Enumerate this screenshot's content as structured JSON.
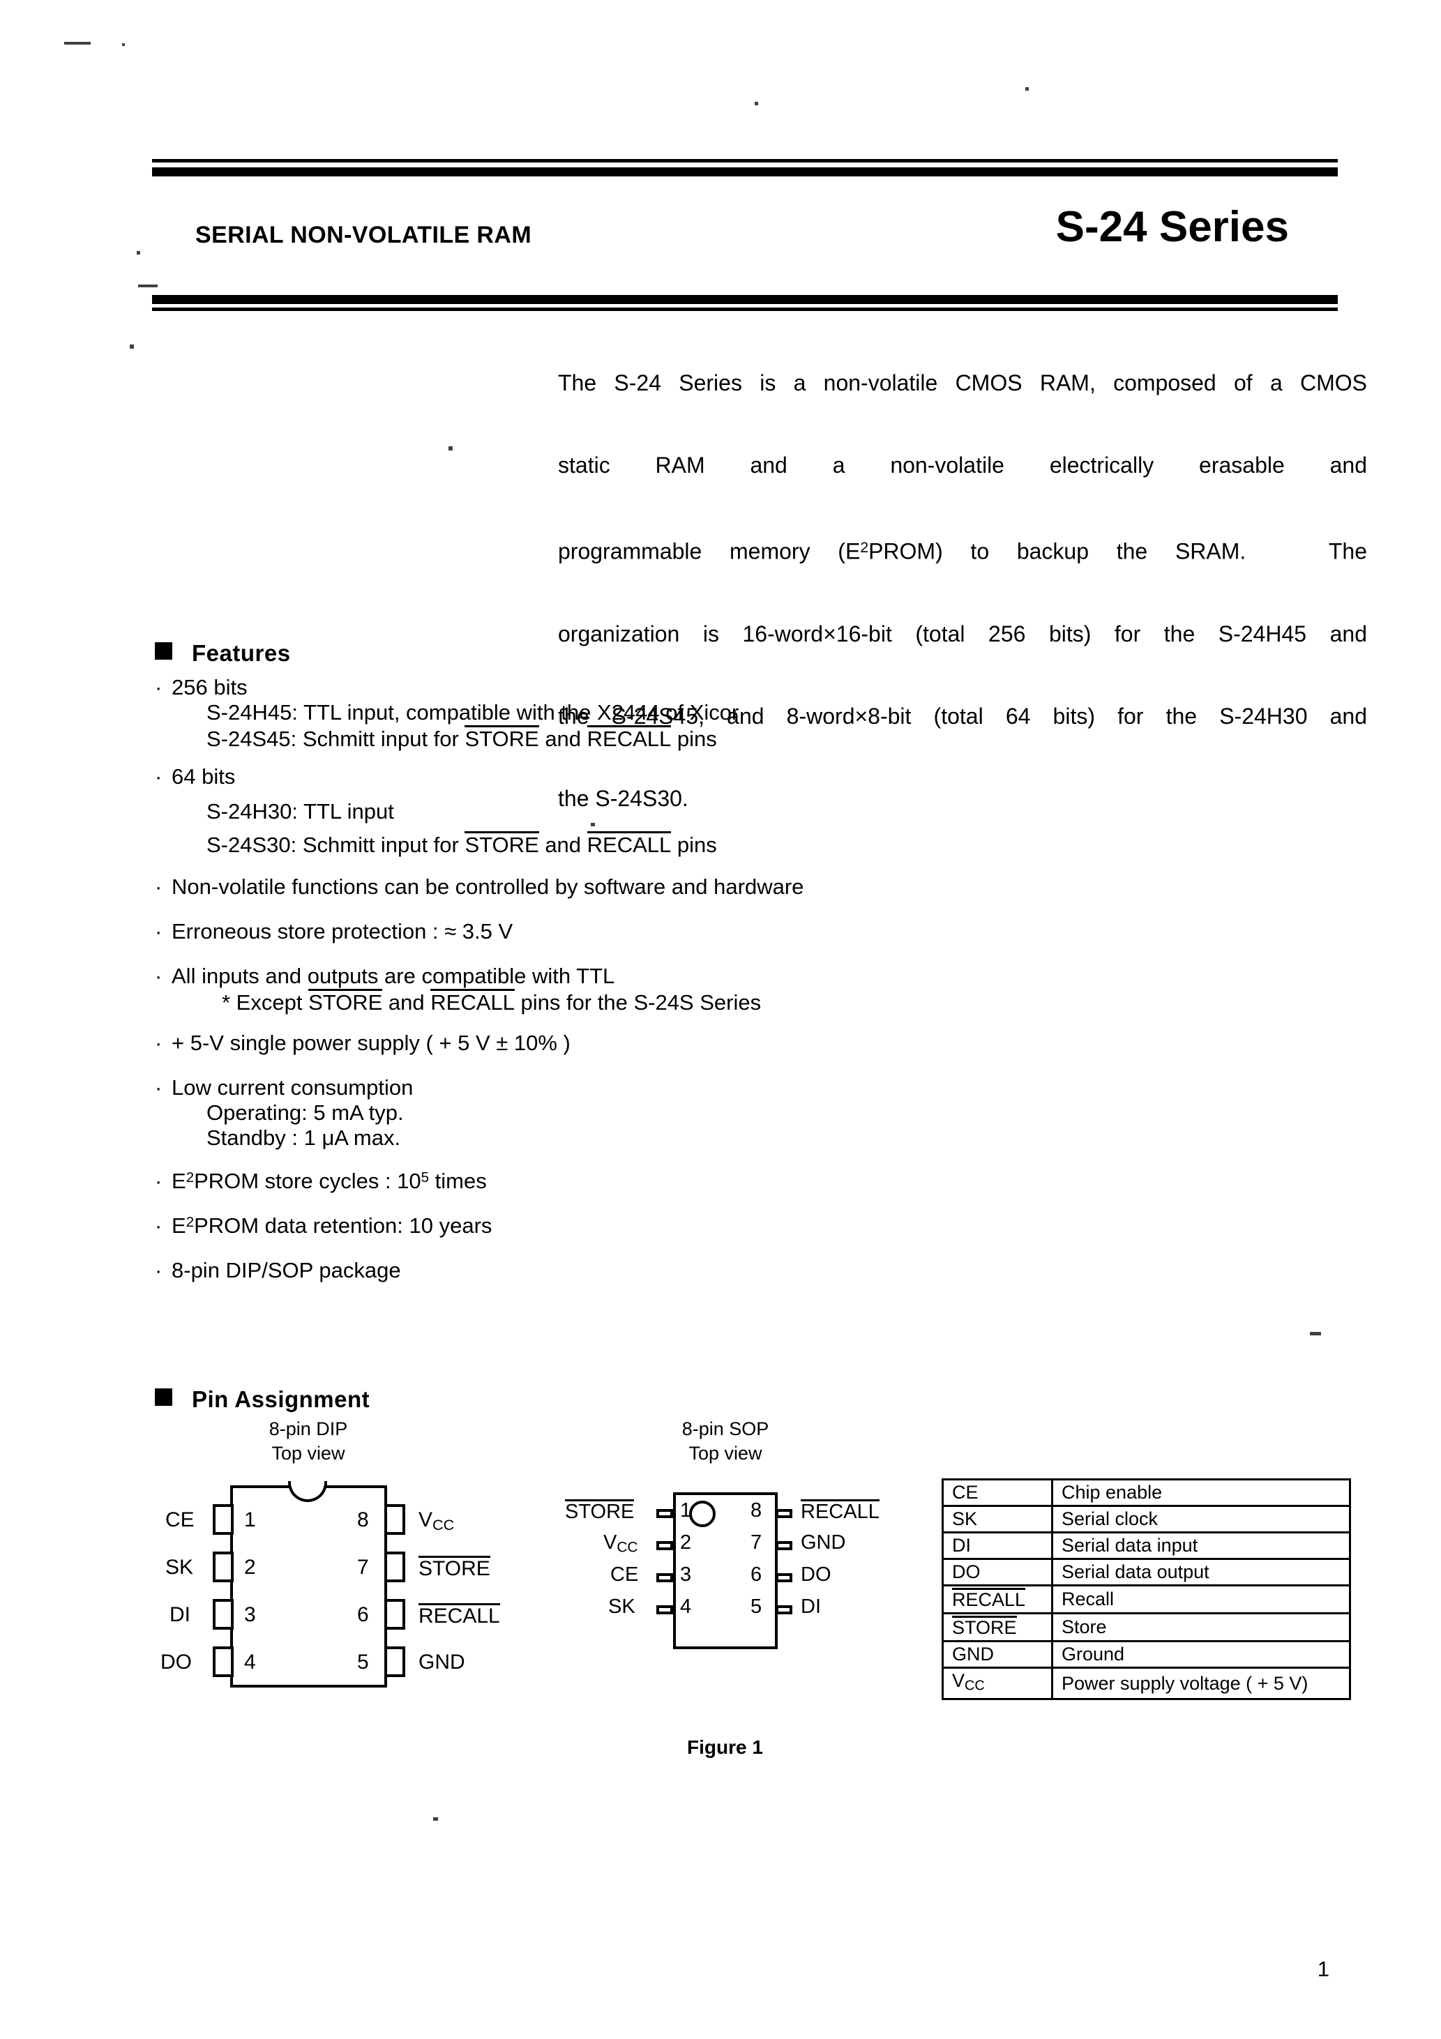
{
  "header": {
    "subtitle": "SERIAL NON-VOLATILE RAM",
    "title": "S-24 Series"
  },
  "intro": {
    "line1": "The S-24 Series is a non-volatile CMOS RAM, composed of a CMOS",
    "line2": "static RAM and a non-volatile electrically erasable and",
    "line3": "programmable memory (E2PROM) to backup the SRAM.   The",
    "line4": "organization is 16-word×16-bit (total 256 bits) for the S-24H45 and",
    "line5": "the S-24S45, and 8-word×8-bit (total 64 bits) for the S-24H30 and",
    "line6": "the S-24S30."
  },
  "features": {
    "heading": "Features",
    "items": [
      {
        "main": "256 bits",
        "subs": [
          "S-24H45: TTL input, compatible with the X2444 of Xicor",
          "S-24S45: Schmitt input for STORE and RECALL pins"
        ]
      },
      {
        "main": "64 bits",
        "subs": [
          "S-24H30: TTL input",
          "S-24S30: Schmitt input for STORE and RECALL pins"
        ]
      },
      {
        "main": "Non-volatile functions can be controlled by software and hardware",
        "subs": []
      },
      {
        "main": "Erroneous store protection : ≈ 3.5 V",
        "subs": []
      },
      {
        "main": "All inputs and outputs are compatible with TTL",
        "subs": [
          "* Except STORE and RECALL pins for the S-24S Series"
        ]
      },
      {
        "main": "+ 5-V single power supply ( + 5 V ± 10% )",
        "subs": []
      },
      {
        "main": "Low current consumption",
        "subs": [
          "Operating:  5 mA typ.",
          "Standby  :  1 μA  max."
        ]
      },
      {
        "main": "E2PROM store cycles : 105 times",
        "subs": []
      },
      {
        "main": "E2PROM data retention: 10 years",
        "subs": []
      },
      {
        "main": "8-pin DIP/SOP package",
        "subs": []
      }
    ],
    "labels": {
      "f1_main": "256 bits",
      "f1_s1": "S-24H45: TTL input, compatible with the X2444 of Xicor",
      "f1_s2_a": "S-24S45: Schmitt input for ",
      "f1_s2_store": "STORE",
      "f1_s2_b": " and ",
      "f1_s2_recall": "RECALL",
      "f1_s2_c": " pins",
      "f2_main": "64 bits",
      "f2_s1": "S-24H30: TTL input",
      "f2_s2_a": "S-24S30: Schmitt input for ",
      "f3_main": "Non-volatile functions can be controlled by software and hardware",
      "f4_main": "Erroneous store protection : ≈ 3.5 V",
      "f5_main": "All inputs and outputs are compatible with TTL",
      "f5_s1_a": "* Except ",
      "f5_s1_c": " pins for the S-24S Series",
      "f6_main": "+ 5-V single power supply ( + 5 V ± 10% )",
      "f7_main": "Low current consumption",
      "f7_s1": "Operating:  5 mA typ.",
      "f7_s2": "Standby  :  1 μA  max.",
      "f8_pre": "E",
      "f8_sup": "2",
      "f8_post": "PROM store cycles : 10",
      "f8_exp": "5",
      "f8_tail": " times",
      "f9_post": "PROM data retention: 10 years",
      "f10_main": "8-pin DIP/SOP package",
      "bullet": "·"
    }
  },
  "pin_assignment": {
    "heading": "Pin Assignment",
    "dip": {
      "title_line1": "8-pin DIP",
      "title_line2": "Top view",
      "left": [
        {
          "num": "1",
          "label": "CE",
          "overline": false
        },
        {
          "num": "2",
          "label": "SK",
          "overline": false
        },
        {
          "num": "3",
          "label": "DI",
          "overline": false
        },
        {
          "num": "4",
          "label": "DO",
          "overline": false
        }
      ],
      "right": [
        {
          "num": "8",
          "label": "Vcc",
          "overline": false
        },
        {
          "num": "7",
          "label": "STORE",
          "overline": true
        },
        {
          "num": "6",
          "label": "RECALL",
          "overline": true
        },
        {
          "num": "5",
          "label": "GND",
          "overline": false
        }
      ]
    },
    "sop": {
      "title_line1": "8-pin SOP",
      "title_line2": "Top view",
      "left": [
        {
          "num": "1",
          "label": "STORE",
          "overline": true
        },
        {
          "num": "2",
          "label": "Vcc",
          "overline": false
        },
        {
          "num": "3",
          "label": "CE",
          "overline": false
        },
        {
          "num": "4",
          "label": "SK",
          "overline": false
        }
      ],
      "right": [
        {
          "num": "8",
          "label": "RECALL",
          "overline": true
        },
        {
          "num": "7",
          "label": "GND",
          "overline": false
        },
        {
          "num": "6",
          "label": "DO",
          "overline": false
        },
        {
          "num": "5",
          "label": "DI",
          "overline": false
        }
      ]
    },
    "table": [
      {
        "symbol": "CE",
        "overline": false,
        "description": "Chip enable"
      },
      {
        "symbol": "SK",
        "overline": false,
        "description": "Serial clock"
      },
      {
        "symbol": "DI",
        "overline": false,
        "description": "Serial data input"
      },
      {
        "symbol": "DO",
        "overline": false,
        "description": "Serial data output"
      },
      {
        "symbol": "RECALL",
        "overline": true,
        "description": "Recall"
      },
      {
        "symbol": "STORE",
        "overline": true,
        "description": "Store"
      },
      {
        "symbol": "GND",
        "overline": false,
        "description": "Ground"
      },
      {
        "symbol": "Vcc",
        "overline": false,
        "description": "Power supply voltage ( + 5 V)"
      }
    ],
    "figure_caption": "Figure 1"
  },
  "footer": {
    "page_number": "1"
  }
}
